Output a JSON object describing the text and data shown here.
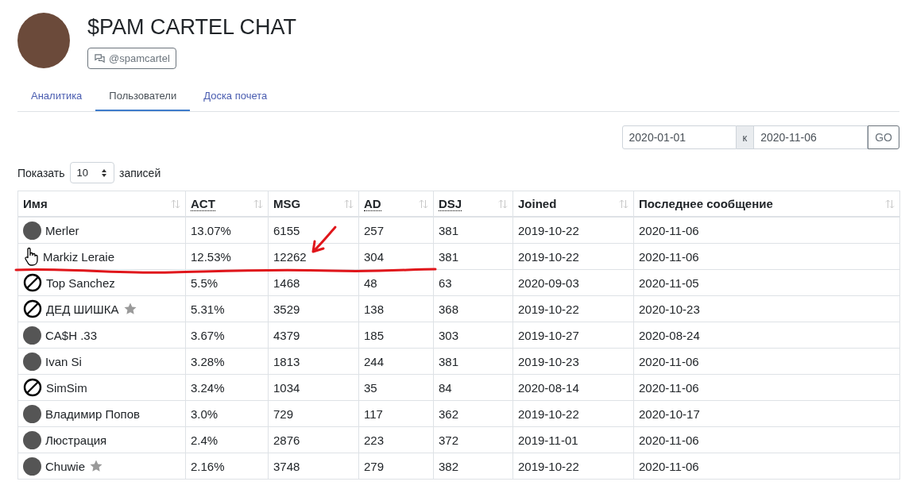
{
  "header": {
    "title": "$PAM CARTEL CHAT",
    "handle": "@spamcartel"
  },
  "tabs": [
    {
      "label": "Аналитика",
      "selected": false
    },
    {
      "label": "Пользователи",
      "selected": true
    },
    {
      "label": "Доска почета",
      "selected": false
    }
  ],
  "date_filter": {
    "from": "2020-01-01",
    "separator": "к",
    "to": "2020-11-06",
    "button": "GO"
  },
  "page_length": {
    "label_before": "Показать",
    "value": "10",
    "label_after": "записей"
  },
  "table": {
    "columns": [
      {
        "label": "Имя",
        "abbr": false
      },
      {
        "label": "ACT",
        "abbr": true
      },
      {
        "label": "MSG",
        "abbr": false
      },
      {
        "label": "AD",
        "abbr": true
      },
      {
        "label": "DSJ",
        "abbr": true
      },
      {
        "label": "Joined",
        "abbr": false
      },
      {
        "label": "Последнее сообщение",
        "abbr": false
      }
    ],
    "rows": [
      {
        "avatar": {
          "kind": "photo"
        },
        "starred": false,
        "cells": [
          "Merler",
          "13.07%",
          "6155",
          "257",
          "381",
          "2019-10-22",
          "2020-11-06"
        ]
      },
      {
        "avatar": {
          "kind": "hand"
        },
        "starred": false,
        "cells": [
          "Markiz Leraie",
          "12.53%",
          "12262",
          "304",
          "381",
          "2019-10-22",
          "2020-11-06"
        ]
      },
      {
        "avatar": {
          "kind": "blocked"
        },
        "starred": false,
        "cells": [
          "Top Sanchez",
          "5.5%",
          "1468",
          "48",
          "63",
          "2020-09-03",
          "2020-11-05"
        ]
      },
      {
        "avatar": {
          "kind": "blocked"
        },
        "starred": true,
        "cells": [
          "ДЕД ШИШКА",
          "5.31%",
          "3529",
          "138",
          "368",
          "2019-10-22",
          "2020-10-23"
        ]
      },
      {
        "avatar": {
          "kind": "photo"
        },
        "starred": false,
        "cells": [
          "CA$H .33",
          "3.67%",
          "4379",
          "185",
          "303",
          "2019-10-27",
          "2020-08-24"
        ]
      },
      {
        "avatar": {
          "kind": "photo"
        },
        "starred": false,
        "cells": [
          "Ivan Si",
          "3.28%",
          "1813",
          "244",
          "381",
          "2019-10-23",
          "2020-11-06"
        ]
      },
      {
        "avatar": {
          "kind": "blocked"
        },
        "starred": false,
        "cells": [
          "SimSim",
          "3.24%",
          "1034",
          "35",
          "84",
          "2020-08-14",
          "2020-11-06"
        ]
      },
      {
        "avatar": {
          "kind": "photo"
        },
        "starred": false,
        "cells": [
          "Владимир Попов",
          "3.0%",
          "729",
          "117",
          "362",
          "2019-10-22",
          "2020-10-17"
        ]
      },
      {
        "avatar": {
          "kind": "photo"
        },
        "starred": false,
        "cells": [
          "Люстрация",
          "2.4%",
          "2876",
          "223",
          "372",
          "2019-11-01",
          "2020-11-06"
        ]
      },
      {
        "avatar": {
          "kind": "photo"
        },
        "starred": true,
        "cells": [
          "Chuwie",
          "2.16%",
          "3748",
          "279",
          "382",
          "2019-10-22",
          "2020-11-06"
        ]
      }
    ]
  }
}
